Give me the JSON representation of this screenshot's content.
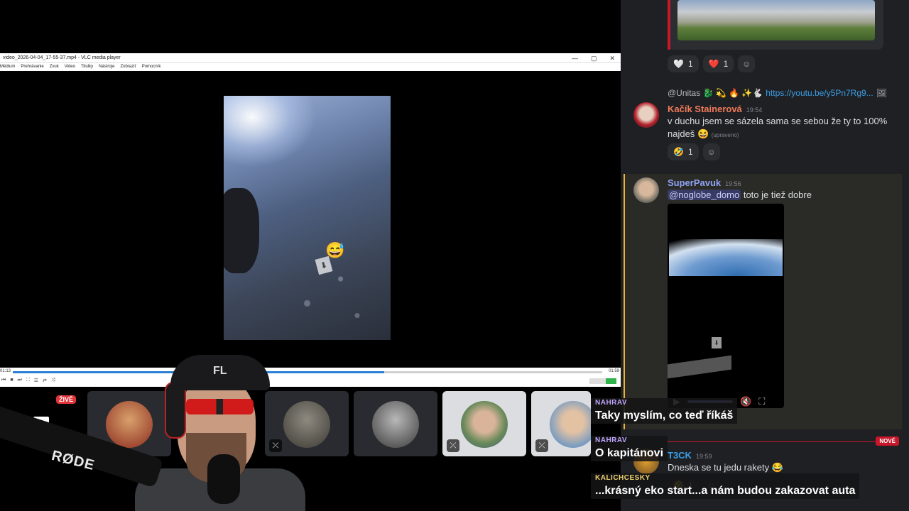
{
  "vlc": {
    "title": "video_2026-04-04_17-55-37.mp4 - VLC media player",
    "window_controls": [
      "—",
      "▢",
      "✕"
    ],
    "menu": [
      "Médium",
      "Prehrávanie",
      "Zvuk",
      "Video",
      "Titulky",
      "Nástroje",
      "Zobraziť",
      "Pomocník"
    ],
    "time_elapsed": "01:13",
    "time_total": "01:59",
    "progress_fraction": 0.63,
    "controls": [
      "⏮",
      "■",
      "⏭",
      "⛶",
      "☰",
      "⇄",
      "⤨"
    ]
  },
  "strip": {
    "live_badge": "ŽIVĚ",
    "tile_mute_icon": "⤫"
  },
  "streamer": {
    "mic_brand": "RØDE",
    "cap_logo": "FL"
  },
  "discord": {
    "top_reactions": [
      {
        "emoji": "🤍",
        "count": "1"
      },
      {
        "emoji": "❤️",
        "count": "1"
      }
    ],
    "msg1": {
      "reply_author": "@Unitas 🐉 💫 🔥 ✨🐇",
      "reply_link": "https://youtu.be/y5Pn7Rg9...",
      "author": "Kačík Stainerová",
      "time": "19:54",
      "text": "v duchu jsem se sázela sama se sebou že ty to 100% najdeš",
      "emoji": "😆",
      "edited": "(upraveno)",
      "reaction": {
        "emoji": "🤣",
        "count": "1"
      }
    },
    "msg2": {
      "author": "SuperPavuk",
      "time": "19:56",
      "mention": "@noglobe_domo",
      "text": "toto je tiež dobre"
    },
    "new_badge": "NOVÉ",
    "msg3": {
      "author": "T3CK",
      "time": "19:59",
      "text": "Dneska se tu jedu rakety",
      "emoji": "😂",
      "reaction_count": "1"
    },
    "colors": {
      "accent_red": "#c8172a",
      "mention_bg": "#5865f2",
      "highlight": "#f0b232"
    }
  },
  "captions": [
    {
      "name": "NAHRAV",
      "text": "Taky myslím, co teď říkáš"
    },
    {
      "name": "NAHRAV",
      "text": "O kapitánovi"
    },
    {
      "name": "KALICHCESKY",
      "text": "...krásný eko start...a nám budou zakazovat auta"
    }
  ]
}
